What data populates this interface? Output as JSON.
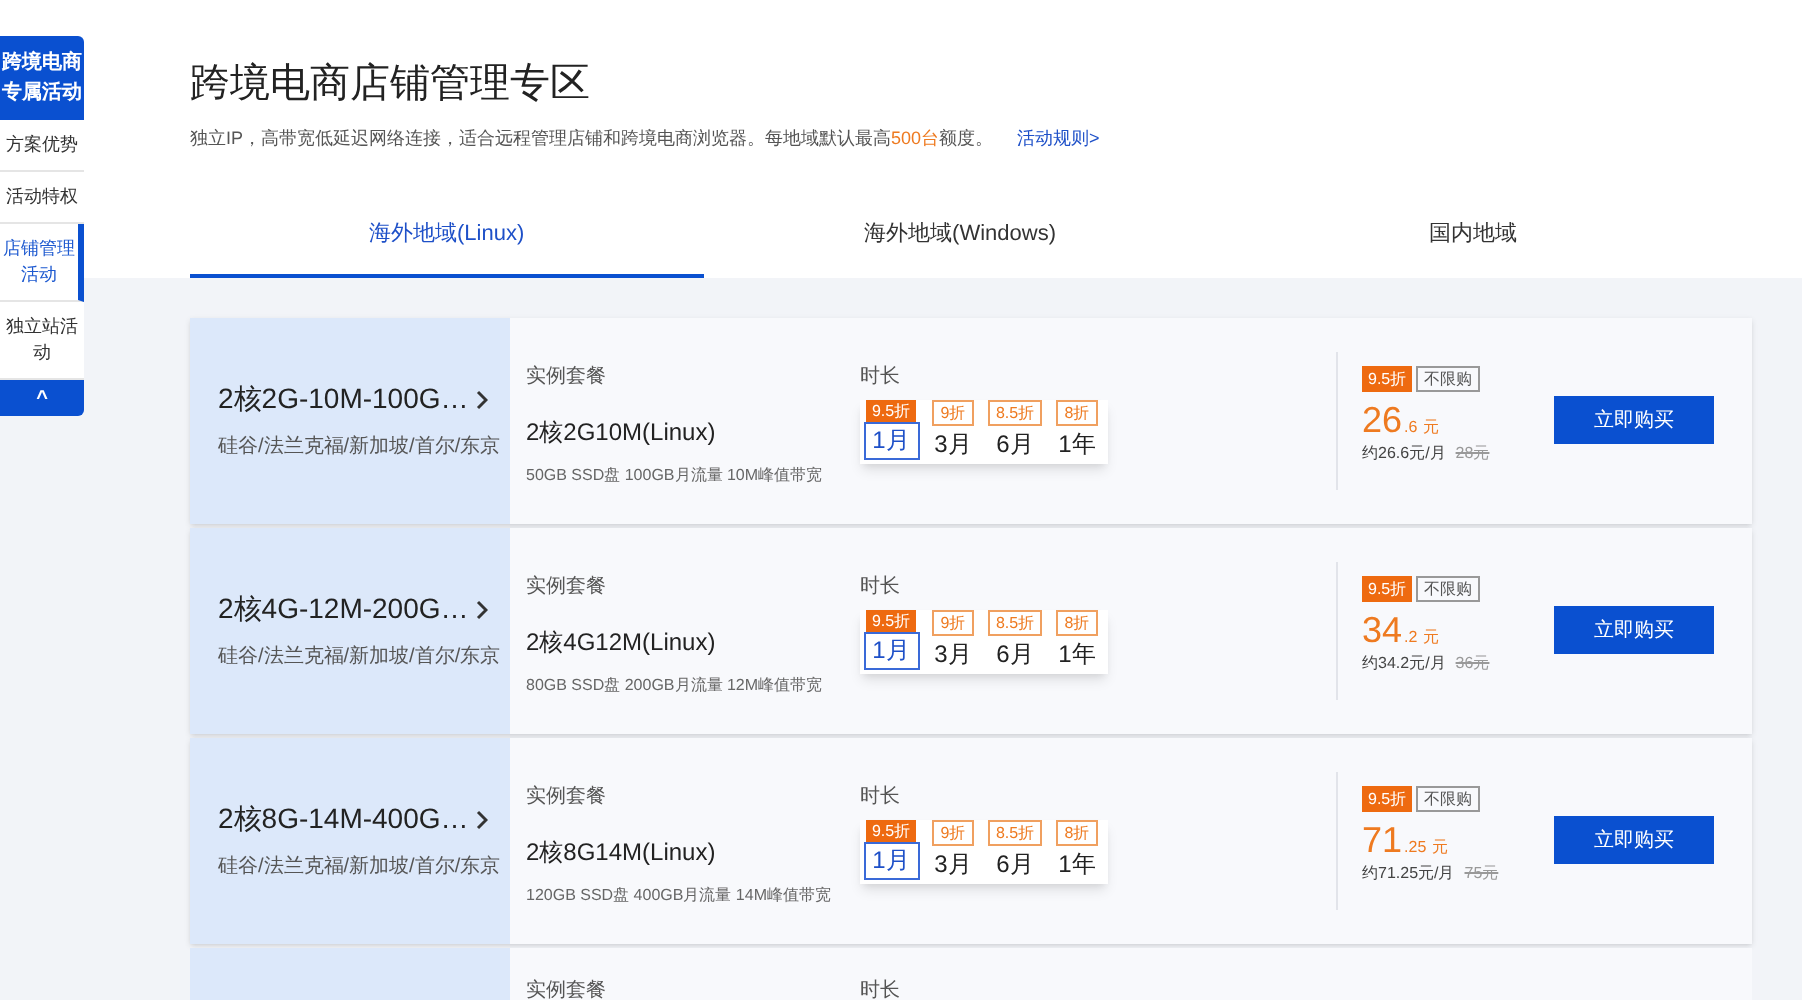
{
  "sidebar": {
    "header": [
      "跨境电商",
      "专属活动"
    ],
    "items": [
      {
        "label": "方案优势",
        "selected": false
      },
      {
        "label": "活动特权",
        "selected": false
      },
      {
        "label": "店铺管理活动",
        "selected": true
      },
      {
        "label": "独立站活动",
        "selected": false
      }
    ],
    "collapse": "^"
  },
  "page": {
    "title": "跨境电商店铺管理专区",
    "intro": [
      "独立IP，高带宽低延迟网络连接，适合远程管理店铺和跨境电商浏览器。每地域默认最高",
      "500台",
      "额度。"
    ],
    "rules_link": "活动规则>"
  },
  "tabs": [
    {
      "label": "海外地域(Linux)",
      "selected": true
    },
    {
      "label": "海外地域(Windows)",
      "selected": false
    },
    {
      "label": "国内地域",
      "selected": false
    }
  ],
  "products": [
    {
      "name": "2核2G-10M-100G…",
      "regions": "硅谷/法兰克福/新加坡/首尔/东京",
      "plan_label": "实例套餐",
      "plan": "2核2G10M(Linux)",
      "spec": "50GB SSD盘 100GB月流量 10M峰值带宽",
      "duration_label": "时长",
      "durations": [
        {
          "label": "1月",
          "discount": "9.5折",
          "selected": true
        },
        {
          "label": "3月",
          "discount": "9折",
          "selected": false
        },
        {
          "label": "6月",
          "discount": "8.5折",
          "selected": false
        },
        {
          "label": "1年",
          "discount": "8折",
          "selected": false
        }
      ],
      "discount_tag": "9.5折",
      "limit_tag": "不限购",
      "price_int": "26",
      "price_dec": ".6",
      "currency": "元",
      "monthly": "约26.6元/月",
      "original": "28元",
      "buy": "立即购买"
    },
    {
      "name": "2核4G-12M-200G…",
      "regions": "硅谷/法兰克福/新加坡/首尔/东京",
      "plan_label": "实例套餐",
      "plan": "2核4G12M(Linux)",
      "spec": "80GB SSD盘 200GB月流量 12M峰值带宽",
      "duration_label": "时长",
      "durations": [
        {
          "label": "1月",
          "discount": "9.5折",
          "selected": true
        },
        {
          "label": "3月",
          "discount": "9折",
          "selected": false
        },
        {
          "label": "6月",
          "discount": "8.5折",
          "selected": false
        },
        {
          "label": "1年",
          "discount": "8折",
          "selected": false
        }
      ],
      "discount_tag": "9.5折",
      "limit_tag": "不限购",
      "price_int": "34",
      "price_dec": ".2",
      "currency": "元",
      "monthly": "约34.2元/月",
      "original": "36元",
      "buy": "立即购买"
    },
    {
      "name": "2核8G-14M-400G…",
      "regions": "硅谷/法兰克福/新加坡/首尔/东京",
      "plan_label": "实例套餐",
      "plan": "2核8G14M(Linux)",
      "spec": "120GB SSD盘 400GB月流量 14M峰值带宽",
      "duration_label": "时长",
      "durations": [
        {
          "label": "1月",
          "discount": "9.5折",
          "selected": true
        },
        {
          "label": "3月",
          "discount": "9折",
          "selected": false
        },
        {
          "label": "6月",
          "discount": "8.5折",
          "selected": false
        },
        {
          "label": "1年",
          "discount": "8折",
          "selected": false
        }
      ],
      "discount_tag": "9.5折",
      "limit_tag": "不限购",
      "price_int": "71",
      "price_dec": ".25",
      "currency": "元",
      "monthly": "约71.25元/月",
      "original": "75元",
      "buy": "立即购买"
    }
  ],
  "partial_product": {
    "plan_label": "实例套餐",
    "duration_label": "时长"
  }
}
